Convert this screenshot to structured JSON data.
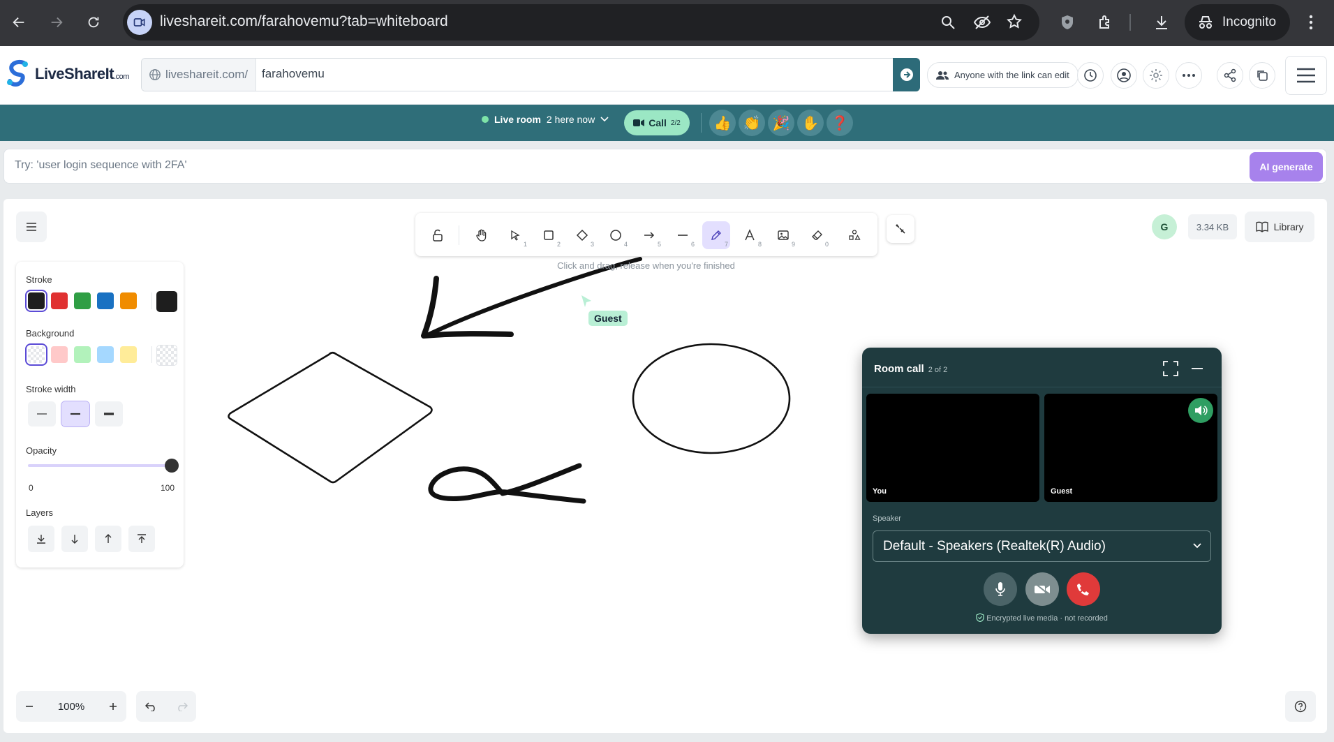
{
  "browser": {
    "url": "liveshareit.com/farahovemu?tab=whiteboard",
    "incognito_label": "Incognito"
  },
  "app": {
    "logo_text": "LiveShareIt",
    "logo_suffix": ".com",
    "url_prefix": "liveshareit.com/",
    "room_slug": "farahovemu",
    "share_label": "Anyone with the link can edit"
  },
  "livebar": {
    "live_label": "Live room",
    "here_now": "2 here now",
    "call_label": "Call",
    "call_count": "2/2",
    "reactions": [
      "👍",
      "👏",
      "🎉",
      "✋",
      "❓"
    ]
  },
  "ai": {
    "placeholder": "Try: 'user login sequence with 2FA'",
    "button": "AI generate"
  },
  "toolbar": {
    "tools": [
      {
        "name": "lock",
        "key": ""
      },
      {
        "name": "hand",
        "key": ""
      },
      {
        "name": "select",
        "key": "1"
      },
      {
        "name": "rectangle",
        "key": "2"
      },
      {
        "name": "diamond",
        "key": "3"
      },
      {
        "name": "ellipse",
        "key": "4"
      },
      {
        "name": "arrow",
        "key": "5"
      },
      {
        "name": "line",
        "key": "6"
      },
      {
        "name": "draw",
        "key": "7"
      },
      {
        "name": "text",
        "key": "8"
      },
      {
        "name": "image",
        "key": "9"
      },
      {
        "name": "eraser",
        "key": "0"
      },
      {
        "name": "shapes",
        "key": ""
      }
    ],
    "hint": "Click and drag, release when you're finished"
  },
  "topright": {
    "avatar_initial": "G",
    "file_size": "3.34 KB",
    "library_label": "Library"
  },
  "props": {
    "stroke_label": "Stroke",
    "stroke_colors": [
      "#1e1e1e",
      "#e03131",
      "#2f9e44",
      "#1971c2",
      "#f08c00"
    ],
    "stroke_current": "#1e1e1e",
    "background_label": "Background",
    "background_colors": [
      "transparent",
      "#ffc9c9",
      "#b2f2bb",
      "#a5d8ff",
      "#ffec99"
    ],
    "stroke_width_label": "Stroke width",
    "opacity_label": "Opacity",
    "opacity_min": "0",
    "opacity_max": "100",
    "opacity_value": 100,
    "layers_label": "Layers"
  },
  "zoom": {
    "level": "100%"
  },
  "cursor": {
    "user": "Guest"
  },
  "call": {
    "title": "Room call",
    "count": "2 of 2",
    "you_label": "You",
    "guest_label": "Guest",
    "speaker_label": "Speaker",
    "speaker_value": "Default - Speakers (Realtek(R) Audio)",
    "encrypted_note": "Encrypted live media · not recorded"
  }
}
